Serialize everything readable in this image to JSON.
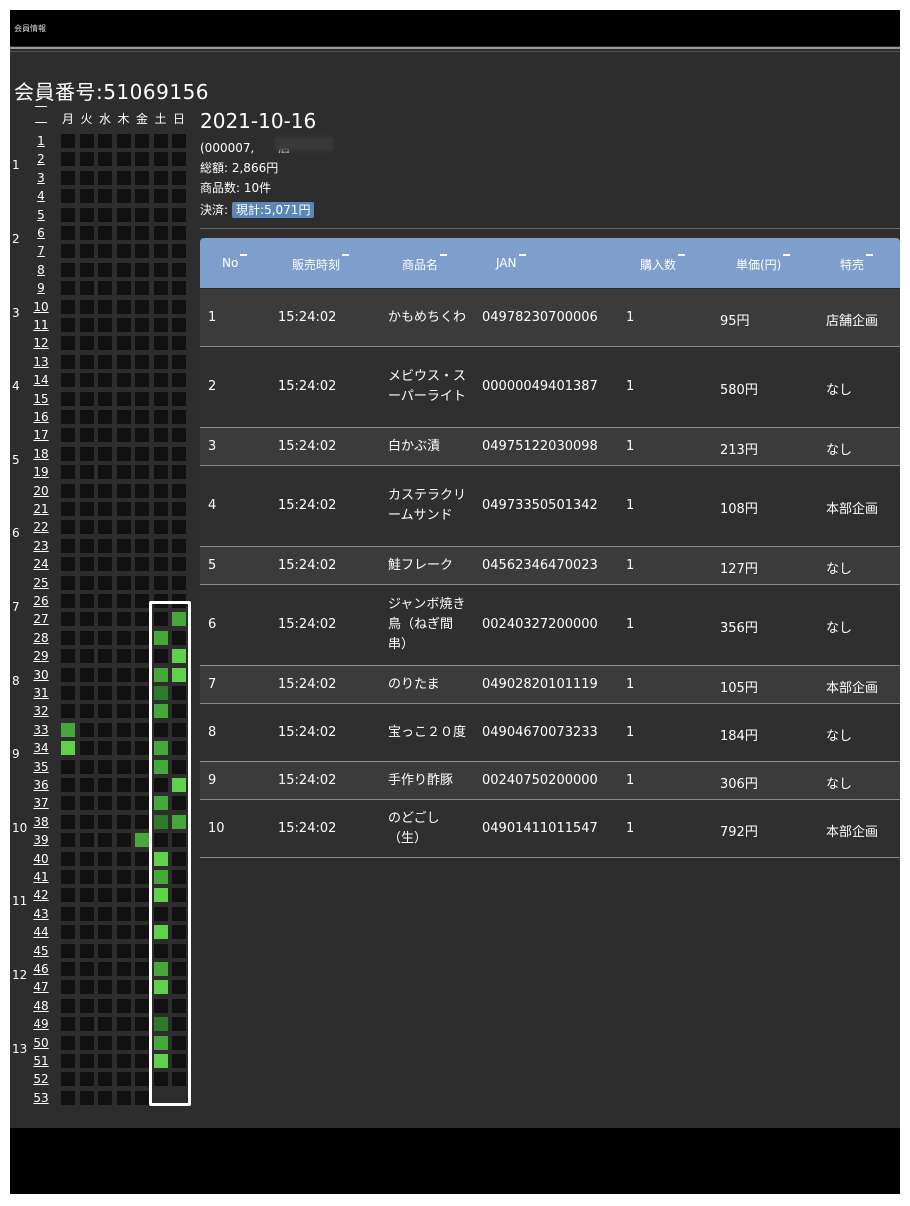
{
  "window_title": "会員情報",
  "member_label": "会員番号:51069156",
  "weekday_headers": [
    "月",
    "火",
    "水",
    "木",
    "金",
    "土",
    "日"
  ],
  "weeks": [
    "1",
    "2",
    "3",
    "4",
    "5",
    "6",
    "7",
    "8",
    "9",
    "10",
    "11",
    "12",
    "13",
    "14",
    "15",
    "16",
    "17",
    "18",
    "19",
    "20",
    "21",
    "22",
    "23",
    "24",
    "25",
    "26",
    "27",
    "28",
    "29",
    "30",
    "31",
    "32",
    "33",
    "34",
    "35",
    "36",
    "37",
    "38",
    "39",
    "40",
    "41",
    "42",
    "43",
    "44",
    "45",
    "46",
    "47",
    "48",
    "49",
    "50",
    "51",
    "52",
    "53"
  ],
  "months": [
    {
      "label": "1",
      "week": 2
    },
    {
      "label": "2",
      "week": 6
    },
    {
      "label": "3",
      "week": 10
    },
    {
      "label": "4",
      "week": 14
    },
    {
      "label": "5",
      "week": 18
    },
    {
      "label": "6",
      "week": 22
    },
    {
      "label": "7",
      "week": 26
    },
    {
      "label": "8",
      "week": 30
    },
    {
      "label": "9",
      "week": 34
    },
    {
      "label": "10",
      "week": 38
    },
    {
      "label": "11",
      "week": 42
    },
    {
      "label": "12",
      "week": 46
    },
    {
      "label": "13",
      "week": 50
    }
  ],
  "purchase_cells": [
    {
      "week": 27,
      "day": 6,
      "level": "medium"
    },
    {
      "week": 28,
      "day": 5,
      "level": "medium"
    },
    {
      "week": 29,
      "day": 6,
      "level": "bright"
    },
    {
      "week": 30,
      "day": 5,
      "level": "medium"
    },
    {
      "week": 30,
      "day": 6,
      "level": "bright"
    },
    {
      "week": 31,
      "day": 5,
      "level": "dark"
    },
    {
      "week": 32,
      "day": 5,
      "level": "medium"
    },
    {
      "week": 33,
      "day": 0,
      "level": "medium"
    },
    {
      "week": 34,
      "day": 0,
      "level": "bright"
    },
    {
      "week": 34,
      "day": 5,
      "level": "medium"
    },
    {
      "week": 35,
      "day": 5,
      "level": "medium"
    },
    {
      "week": 36,
      "day": 6,
      "level": "bright"
    },
    {
      "week": 37,
      "day": 5,
      "level": "medium"
    },
    {
      "week": 38,
      "day": 5,
      "level": "dark"
    },
    {
      "week": 38,
      "day": 6,
      "level": "medium"
    },
    {
      "week": 39,
      "day": 4,
      "level": "medium"
    },
    {
      "week": 40,
      "day": 5,
      "level": "bright"
    },
    {
      "week": 41,
      "day": 5,
      "level": "medium"
    },
    {
      "week": 42,
      "day": 5,
      "level": "bright"
    },
    {
      "week": 44,
      "day": 5,
      "level": "bright"
    },
    {
      "week": 46,
      "day": 5,
      "level": "medium"
    },
    {
      "week": 47,
      "day": 5,
      "level": "bright"
    },
    {
      "week": 49,
      "day": 5,
      "level": "dark"
    },
    {
      "week": 50,
      "day": 5,
      "level": "medium"
    },
    {
      "week": 51,
      "day": 5,
      "level": "bright"
    }
  ],
  "receipt": {
    "date": "2021-10-16",
    "store_line": "(000007,　　店",
    "total": "総額: 2,866円",
    "item_count": "商品数: 10件",
    "payment_label": "決済:",
    "payment_value": "現計:5,071円"
  },
  "table": {
    "headers": [
      "No",
      "販売時刻",
      "商品名",
      "JAN",
      "購入数",
      "単価(円)",
      "特売"
    ],
    "rows": [
      {
        "no": "1",
        "time": "15:24:02",
        "name": "かもめちくわ",
        "jan": "04978230700006",
        "qty": "1",
        "price": "95円",
        "sale": "店舗企画"
      },
      {
        "no": "2",
        "time": "15:24:02",
        "name": "メビウス・スーパーライト",
        "jan": "00000049401387",
        "qty": "1",
        "price": "580円",
        "sale": "なし"
      },
      {
        "no": "3",
        "time": "15:24:02",
        "name": "白かぶ漬",
        "jan": "04975122030098",
        "qty": "1",
        "price": "213円",
        "sale": "なし"
      },
      {
        "no": "4",
        "time": "15:24:02",
        "name": "カステラクリームサンド",
        "jan": "04973350501342",
        "qty": "1",
        "price": "108円",
        "sale": "本部企画"
      },
      {
        "no": "5",
        "time": "15:24:02",
        "name": "鮭フレーク",
        "jan": "04562346470023",
        "qty": "1",
        "price": "127円",
        "sale": "なし"
      },
      {
        "no": "6",
        "time": "15:24:02",
        "name": "ジャンボ焼き鳥（ねぎ間串）",
        "jan": "00240327200000",
        "qty": "1",
        "price": "356円",
        "sale": "なし"
      },
      {
        "no": "7",
        "time": "15:24:02",
        "name": "のりたま",
        "jan": "04902820101119",
        "qty": "1",
        "price": "105円",
        "sale": "本部企画"
      },
      {
        "no": "8",
        "time": "15:24:02",
        "name": "宝っこ２０度",
        "jan": "04904670073233",
        "qty": "1",
        "price": "184円",
        "sale": "なし"
      },
      {
        "no": "9",
        "time": "15:24:02",
        "name": "手作り酢豚",
        "jan": "00240750200000",
        "qty": "1",
        "price": "306円",
        "sale": "なし"
      },
      {
        "no": "10",
        "time": "15:24:02",
        "name": "のどごし（生）",
        "jan": "04901411011547",
        "qty": "1",
        "price": "792円",
        "sale": "本部企画"
      }
    ]
  },
  "colors": {
    "bright": "#5fd14a",
    "medium": "#46a83a",
    "dark": "#2f7a2a",
    "empty": "#111111",
    "header": "#7e9fcb"
  }
}
